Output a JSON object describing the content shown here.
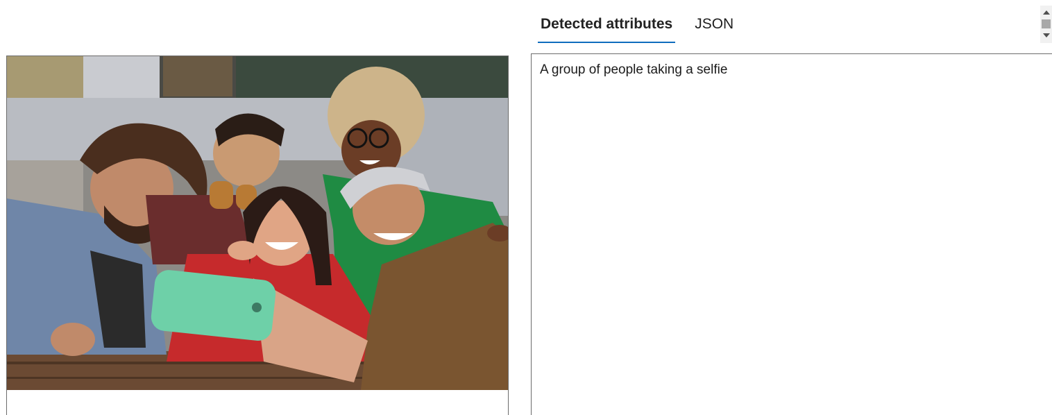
{
  "tabs": [
    {
      "label": "Detected attributes",
      "active": true
    },
    {
      "label": "JSON",
      "active": false
    }
  ],
  "result": {
    "caption": "A group of people taking a selfie"
  },
  "image": {
    "subject": "group-selfie-photo"
  },
  "colors": {
    "accent": "#0f6cbd",
    "border": "#6b6b6b",
    "phone": "#6ed0a8"
  }
}
